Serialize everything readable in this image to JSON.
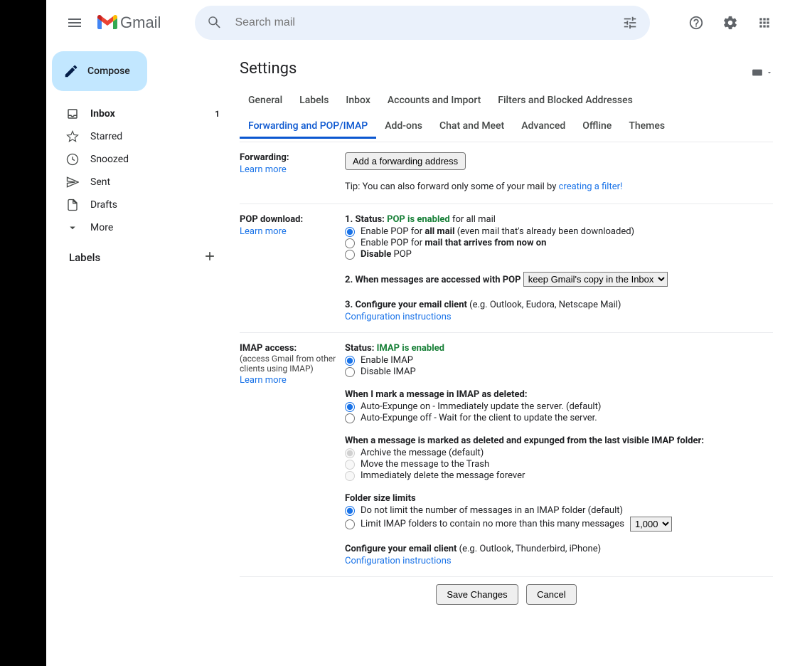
{
  "app_name": "Gmail",
  "search": {
    "placeholder": "Search mail"
  },
  "compose_label": "Compose",
  "sidebar": {
    "items": [
      {
        "label": "Inbox",
        "count": "1"
      },
      {
        "label": "Starred"
      },
      {
        "label": "Snoozed"
      },
      {
        "label": "Sent"
      },
      {
        "label": "Drafts"
      },
      {
        "label": "More"
      }
    ],
    "labels_header": "Labels"
  },
  "page_title": "Settings",
  "tabs": [
    "General",
    "Labels",
    "Inbox",
    "Accounts and Import",
    "Filters and Blocked Addresses",
    "Forwarding and POP/IMAP",
    "Add-ons",
    "Chat and Meet",
    "Advanced",
    "Offline",
    "Themes"
  ],
  "active_tab": "Forwarding and POP/IMAP",
  "forwarding": {
    "title": "Forwarding:",
    "learn_more": "Learn more",
    "add_button": "Add a forwarding address",
    "tip_prefix": "Tip: You can also forward only some of your mail by ",
    "tip_link": "creating a filter!"
  },
  "pop": {
    "title": "POP download:",
    "learn_more": "Learn more",
    "status_prefix": "1. Status: ",
    "status_green": "POP is enabled",
    "status_suffix": " for all mail",
    "opt1_a": "Enable POP for ",
    "opt1_b": "all mail",
    "opt1_c": " (even mail that's already been downloaded)",
    "opt2_a": "Enable POP for ",
    "opt2_b": "mail that arrives from now on",
    "opt3_a": "Disable",
    "opt3_b": " POP",
    "line2": "2. When messages are accessed with POP",
    "select_value": "keep Gmail's copy in the Inbox",
    "line3_a": "3. Configure your email client",
    "line3_b": " (e.g. Outlook, Eudora, Netscape Mail)",
    "config_link": "Configuration instructions"
  },
  "imap": {
    "title": "IMAP access:",
    "sub": "(access Gmail from other clients using IMAP)",
    "learn_more": "Learn more",
    "status_prefix": "Status: ",
    "status_green": "IMAP is enabled",
    "enable": "Enable IMAP",
    "disable": "Disable IMAP",
    "deleted_header": "When I mark a message in IMAP as deleted:",
    "expunge_on": "Auto-Expunge on - Immediately update the server. (default)",
    "expunge_off": "Auto-Expunge off - Wait for the client to update the server.",
    "expunged_header": "When a message is marked as deleted and expunged from the last visible IMAP folder:",
    "archive": "Archive the message (default)",
    "trash": "Move the message to the Trash",
    "delete": "Immediately delete the message forever",
    "folder_header": "Folder size limits",
    "nolimit": "Do not limit the number of messages in an IMAP folder (default)",
    "limit": "Limit IMAP folders to contain no more than this many messages",
    "limit_value": "1,000",
    "config_a": "Configure your email client",
    "config_b": " (e.g. Outlook, Thunderbird, iPhone)",
    "config_link": "Configuration instructions"
  },
  "footer": {
    "save": "Save Changes",
    "cancel": "Cancel"
  }
}
